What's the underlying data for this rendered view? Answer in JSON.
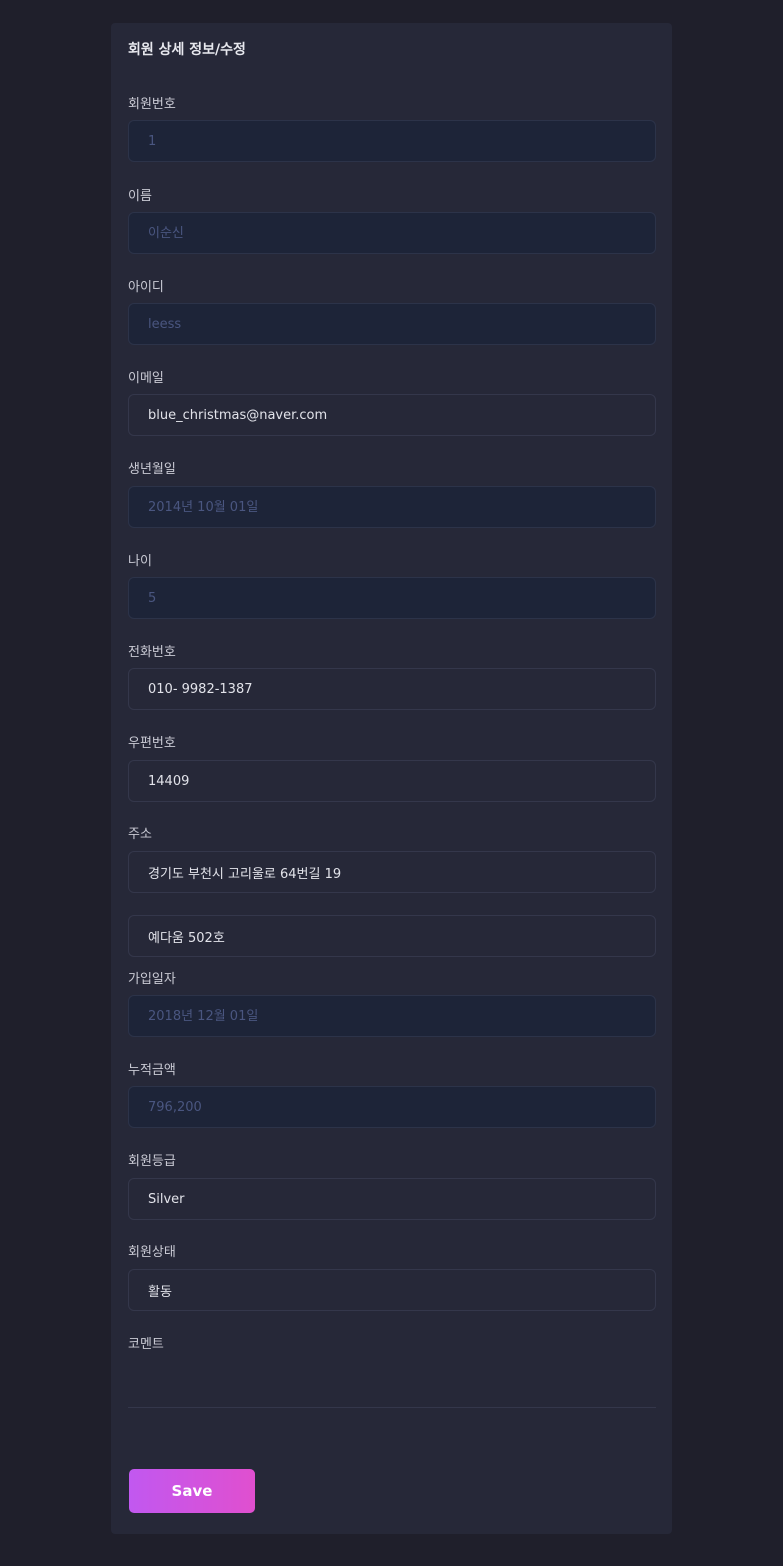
{
  "form": {
    "title": "회원 상세 정보/수정",
    "fields": {
      "member_no": {
        "label": "회원번호",
        "placeholder": "1"
      },
      "name": {
        "label": "이름",
        "placeholder": "이순신"
      },
      "user_id": {
        "label": "아이디",
        "placeholder": "leess"
      },
      "email": {
        "label": "이메일",
        "value": "blue_christmas@naver.com"
      },
      "birthdate": {
        "label": "생년월일",
        "placeholder": "2014년 10월 01일"
      },
      "age": {
        "label": "나이",
        "placeholder": "5"
      },
      "phone": {
        "label": "전화번호",
        "value": "010- 9982-1387"
      },
      "zipcode": {
        "label": "우편번호",
        "value": "14409"
      },
      "address": {
        "label": "주소",
        "value1": "경기도 부천시 고리울로 64번길 19",
        "value2": "예다움 502호"
      },
      "join_date": {
        "label": "가입일자",
        "placeholder": "2018년 12월 01일"
      },
      "total_amount": {
        "label": "누적금액",
        "placeholder": "796,200"
      },
      "grade": {
        "label": "회원등급",
        "value": "Silver"
      },
      "status": {
        "label": "회원상태",
        "value": "활동"
      },
      "comment": {
        "label": "코멘트",
        "value": ""
      }
    },
    "save_label": "Save"
  },
  "colors": {
    "page_background": "#1f1f2b",
    "card_background": "#262838",
    "readonly_field_background": "#1d2438",
    "button_gradient_start": "#c158f0",
    "button_gradient_end": "#e04fcf"
  }
}
